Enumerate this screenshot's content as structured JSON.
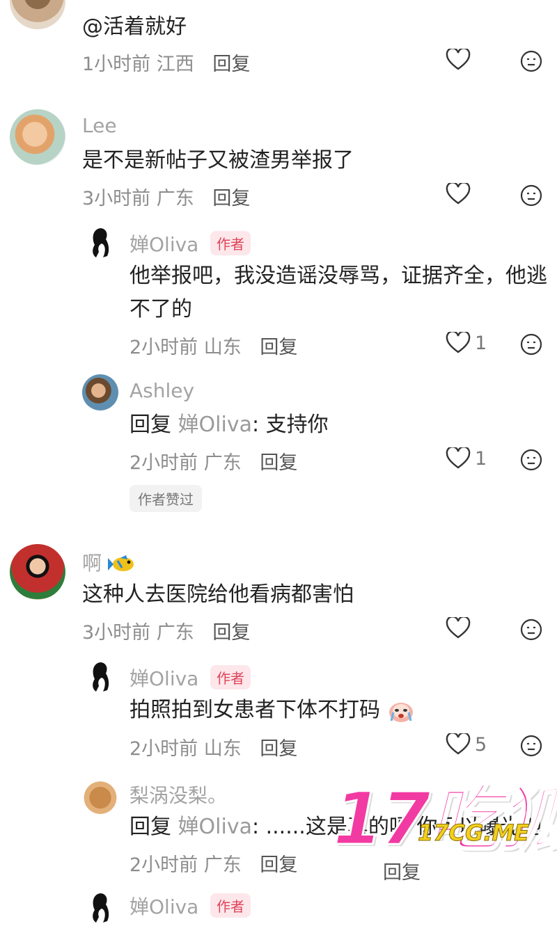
{
  "comments": [
    {
      "text": "@活着就好",
      "meta": {
        "time": "1小时前",
        "region": "江西",
        "reply": "回复"
      },
      "likes": ""
    },
    {
      "name": "Lee",
      "text": "是不是新帖子又被渣男举报了",
      "meta": {
        "time": "3小时前",
        "region": "广东",
        "reply": "回复"
      },
      "likes": "",
      "replies": [
        {
          "name": "婵Oliva",
          "badge": "作者",
          "text_lines": [
            "他举报吧，我没造谣没辱骂，证据齐全，他逃",
            "不了的"
          ],
          "meta": {
            "time": "2小时前",
            "region": "山东",
            "reply": "回复"
          },
          "likes": "1"
        },
        {
          "name": "Ashley",
          "reply_prefix": "回复",
          "reply_to": "婵Oliva",
          "text": ": 支持你",
          "meta": {
            "time": "2小时前",
            "region": "广东",
            "reply": "回复"
          },
          "likes": "1",
          "author_liked": "作者赞过"
        }
      ]
    },
    {
      "name": "啊",
      "text": "这种人去医院给他看病都害怕",
      "meta": {
        "time": "3小时前",
        "region": "广东",
        "reply": "回复"
      },
      "likes": "",
      "replies": [
        {
          "name": "婵Oliva",
          "badge": "作者",
          "text": "拍照拍到女患者下体不打码",
          "meta": {
            "time": "2小时前",
            "region": "山东",
            "reply": "回复"
          },
          "likes": "5"
        },
        {
          "name": "梨涡没梨。",
          "reply_prefix": "回复",
          "reply_to": "婵Oliva",
          "text": ": ......这是真的吗 你可以曝光他",
          "meta": {
            "time": "2小时前",
            "region": "广东",
            "reply": "回复"
          },
          "likes": "",
          "floating_reply": "回复"
        },
        {
          "name": "婵Oliva",
          "badge": "作者"
        }
      ]
    }
  ],
  "watermark": {
    "big": "17吃狐",
    "small": "17CG.ME",
    "color": "#f23aa3"
  }
}
